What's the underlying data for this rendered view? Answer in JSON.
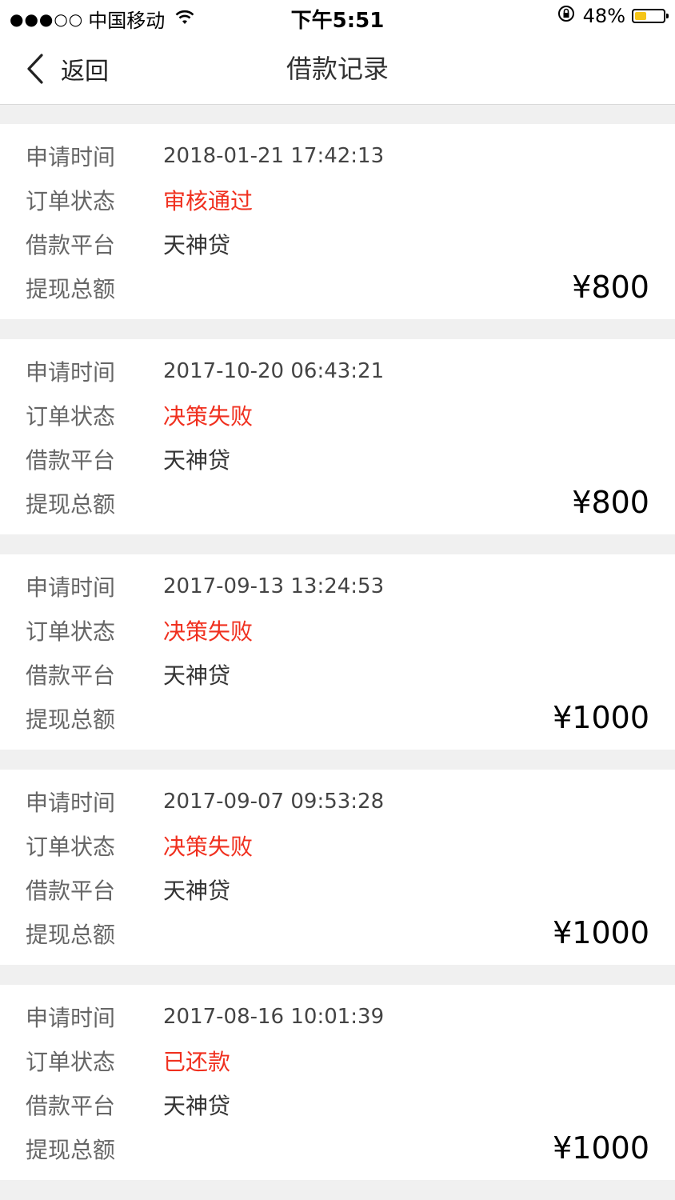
{
  "status_bar": {
    "signal": "●●●○○",
    "carrier": "中国移动",
    "time": "下午5:51",
    "battery_percent": "48%",
    "battery_level": 0.48,
    "battery_color": "#f5c518"
  },
  "nav": {
    "back_label": "返回",
    "title": "借款记录"
  },
  "colors": {
    "status_red": "#f0301f",
    "background": "#f0f0f0"
  },
  "labels": {
    "apply_time": "申请时间",
    "order_status": "订单状态",
    "platform": "借款平台",
    "total_amount": "提现总额"
  },
  "records": [
    {
      "apply_time": "2018-01-21 17:42:13",
      "status": "审核通过",
      "platform": "天神贷",
      "amount": "¥800"
    },
    {
      "apply_time": "2017-10-20 06:43:21",
      "status": "决策失败",
      "platform": "天神贷",
      "amount": "¥800"
    },
    {
      "apply_time": "2017-09-13 13:24:53",
      "status": "决策失败",
      "platform": "天神贷",
      "amount": "¥1000"
    },
    {
      "apply_time": "2017-09-07 09:53:28",
      "status": "决策失败",
      "platform": "天神贷",
      "amount": "¥1000"
    },
    {
      "apply_time": "2017-08-16 10:01:39",
      "status": "已还款",
      "platform": "天神贷",
      "amount": "¥1000"
    }
  ]
}
